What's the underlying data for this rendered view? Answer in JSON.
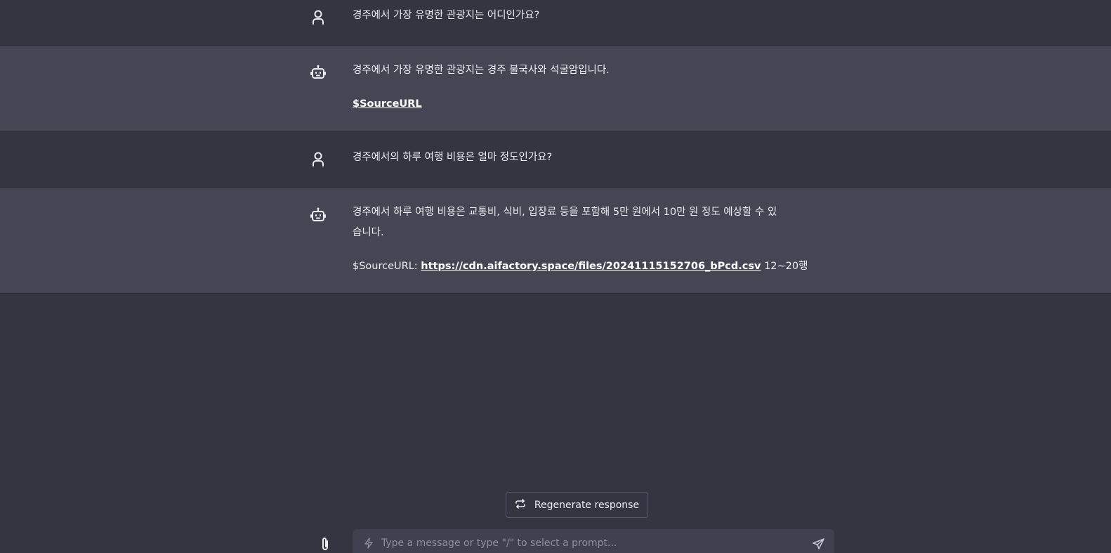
{
  "messages": [
    {
      "role": "user",
      "text": "경주에서 가장 유명한 관광지는 어디인가요?"
    },
    {
      "role": "bot",
      "text": "경주에서 가장 유명한 관광지는 경주 불국사와 석굴암입니다.",
      "source_link": "$SourceURL"
    },
    {
      "role": "user",
      "text": "경주에서의 하루 여행 비용은 얼마 정도인가요?"
    },
    {
      "role": "bot",
      "text_line1": "경주에서 하루 여행 비용은 교통비, 식비, 입장료 등을 포함해 5만 원에서 10만 원 정도 예상할 수 있",
      "text_line2": "습니다.",
      "source_label": "$SourceURL:",
      "source_url": "https://cdn.aifactory.space/files/20241115152706_bPcd.csv",
      "source_rows": "12~20행"
    }
  ],
  "regenerate_label": "Regenerate response",
  "composer": {
    "placeholder": "Type a message or type \"/\" to select a prompt..."
  },
  "colors": {
    "background": "#343541",
    "bot_row": "#444654",
    "text": "#ececf1"
  },
  "icons": [
    "collapse-icon",
    "user-icon",
    "robot-icon",
    "regenerate-icon",
    "paperclip-icon",
    "lightning-icon",
    "send-icon"
  ]
}
